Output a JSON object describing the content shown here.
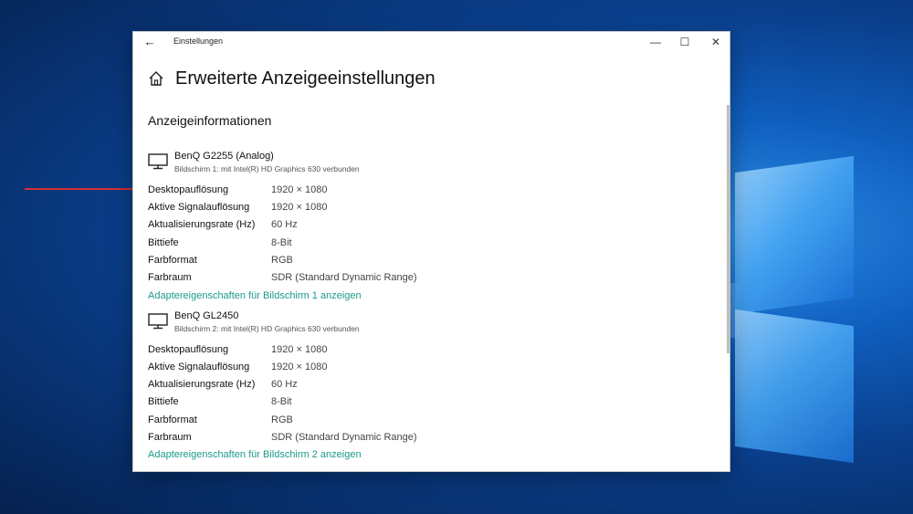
{
  "window": {
    "app_title": "Einstellungen",
    "back_glyph": "←",
    "minimize_glyph": "—",
    "maximize_glyph": "☐",
    "close_glyph": "✕"
  },
  "page": {
    "title": "Erweiterte Anzeigeeinstellungen",
    "section_title": "Anzeigeinformationen"
  },
  "icons": [
    "back-arrow-icon",
    "home-icon",
    "monitor-icon",
    "minimize-icon",
    "maximize-icon",
    "close-icon"
  ],
  "colors": {
    "link": "#1a9a8a",
    "annotation_arrow": "#d32f2f"
  },
  "monitors": [
    {
      "name": "BenQ G2255 (Analog)",
      "subtitle": "Bildschirm 1: mit Intel(R) HD Graphics 630 verbunden",
      "rows": [
        {
          "key": "Desktopauflösung",
          "value": "1920 × 1080"
        },
        {
          "key": "Aktive Signalauflösung",
          "value": "1920 × 1080"
        },
        {
          "key": "Aktualisierungsrate (Hz)",
          "value": "60 Hz"
        },
        {
          "key": "Bittiefe",
          "value": "8-Bit"
        },
        {
          "key": "Farbformat",
          "value": "RGB"
        },
        {
          "key": "Farbraum",
          "value": "SDR (Standard Dynamic Range)"
        }
      ],
      "link": "Adaptereigenschaften für Bildschirm 1 anzeigen"
    },
    {
      "name": "BenQ GL2450",
      "subtitle": "Bildschirm 2: mit Intel(R) HD Graphics 630 verbunden",
      "rows": [
        {
          "key": "Desktopauflösung",
          "value": "1920 × 1080"
        },
        {
          "key": "Aktive Signalauflösung",
          "value": "1920 × 1080"
        },
        {
          "key": "Aktualisierungsrate (Hz)",
          "value": "60 Hz"
        },
        {
          "key": "Bittiefe",
          "value": "8-Bit"
        },
        {
          "key": "Farbformat",
          "value": "RGB"
        },
        {
          "key": "Farbraum",
          "value": "SDR (Standard Dynamic Range)"
        }
      ],
      "link": "Adaptereigenschaften für Bildschirm 2 anzeigen"
    }
  ]
}
